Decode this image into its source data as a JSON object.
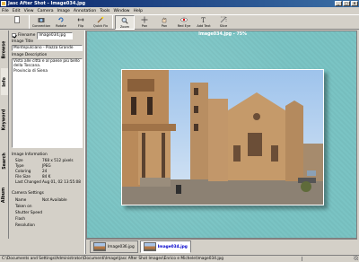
{
  "window": {
    "title": "Jasc After Shot - Image034.jpg"
  },
  "menu": [
    "File",
    "Edit",
    "View",
    "Camera",
    "Image",
    "Annotation",
    "Tools",
    "Window",
    "Help"
  ],
  "toolbar": [
    {
      "label": "",
      "name": "new-button",
      "icon": "new-icon"
    },
    {
      "label": "Connection",
      "name": "connection-button",
      "icon": "camera-icon"
    },
    {
      "label": "Rotate",
      "name": "rotate-button",
      "icon": "rotate-icon"
    },
    {
      "label": "Flip",
      "name": "flip-button",
      "icon": "flip-icon"
    },
    {
      "label": "Quick Fix",
      "name": "quick-fix-button",
      "icon": "quickfix-icon"
    },
    {
      "label": "Zoom",
      "name": "zoom-button",
      "icon": "zoom-icon",
      "active": true
    },
    {
      "label": "Pan",
      "name": "pan-button",
      "icon": "pan-icon"
    },
    {
      "label": "Pan",
      "name": "pan2-button",
      "icon": "hand-icon"
    },
    {
      "label": "Red Eye",
      "name": "red-eye-button",
      "icon": "eye-icon"
    },
    {
      "label": "Add Text",
      "name": "add-text-button",
      "icon": "text-icon"
    },
    {
      "label": "Slice",
      "name": "slice-button",
      "icon": "slice-icon"
    }
  ],
  "left_tabs": [
    "Browse",
    "Info",
    "Keyword",
    "Search",
    "Album"
  ],
  "info": {
    "filename_label": "Filename",
    "filename": "Image034.jpg",
    "title_label": "Image Title",
    "title": "Montepulciano - Piazza Grande",
    "desc_label": "Image Description",
    "description": "Vista alle città e al paese più bello della Toscana.\nProvincia di Siena",
    "info_label": "Image Information",
    "info_rows": [
      {
        "k": "Size",
        "v": "768 x 512 pixels"
      },
      {
        "k": "Type",
        "v": "JPEG"
      },
      {
        "k": "Coloring",
        "v": "24"
      },
      {
        "k": "File Size",
        "v": "84 K"
      },
      {
        "k": "Last Changed",
        "v": "Aug 01, 02 13:55:08"
      }
    ],
    "camera_label": "Camera Settings",
    "camera_rows": [
      {
        "k": "Name",
        "v": "Not Available"
      },
      {
        "k": "Taken on",
        "v": ""
      },
      {
        "k": "Shutter Speed",
        "v": ""
      },
      {
        "k": "Flash",
        "v": ""
      },
      {
        "k": "Resolution",
        "v": ""
      }
    ]
  },
  "viewer": {
    "caption": "Image034.jpg - 75%"
  },
  "thumbnails": [
    {
      "label": "Image036.jpg",
      "selected": false
    },
    {
      "label": "Image034.jpg",
      "selected": true
    }
  ],
  "status": {
    "path": "C:\\Documents and Settings\\Administrator\\Documenti\\Image\\Jasc After Shot Images\\Enrico e Michele\\Image034.jpg"
  }
}
